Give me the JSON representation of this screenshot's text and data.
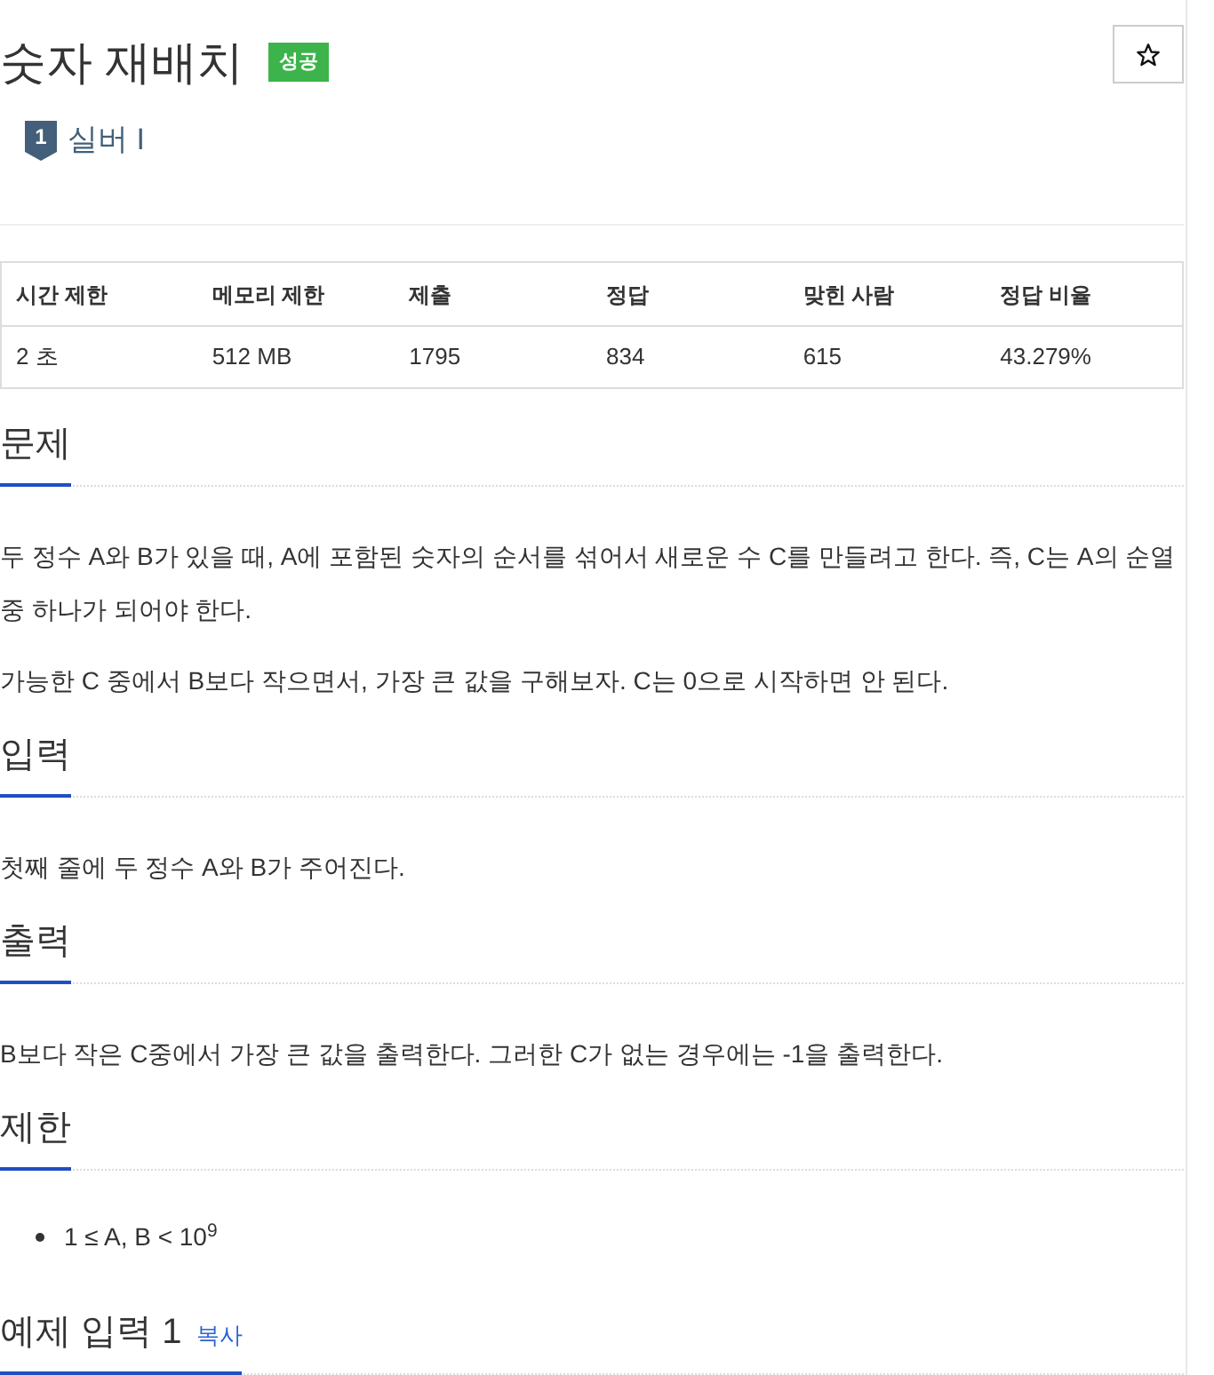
{
  "problem": {
    "title": "숫자 재배치",
    "result_badge": {
      "label": "성공",
      "kind": "success"
    },
    "starred": false
  },
  "tier": {
    "number": "1",
    "label": "실버 I"
  },
  "info_table": {
    "columns": [
      "시간 제한",
      "메모리 제한",
      "제출",
      "정답",
      "맞힌 사람",
      "정답 비율"
    ],
    "rows": [
      [
        "2 초",
        "512 MB",
        "1795",
        "834",
        "615",
        "43.279%"
      ]
    ]
  },
  "sections": [
    {
      "kind": "text",
      "heading": "문제",
      "paragraphs": [
        "두 정수 A와 B가 있을 때, A에 포함된 숫자의 순서를 섞어서 새로운 수 C를 만들려고 한다. 즉, C는 A의 순열 중 하나가 되어야 한다.",
        "가능한 C 중에서 B보다 작으면서, 가장 큰 값을 구해보자. C는 0으로 시작하면 안 된다."
      ]
    },
    {
      "kind": "text",
      "heading": "입력",
      "paragraphs": [
        "첫째 줄에 두 정수 A와 B가 주어진다."
      ]
    },
    {
      "kind": "text",
      "heading": "출력",
      "paragraphs": [
        "B보다 작은 C중에서 가장 큰 값을 출력한다. 그러한 C가 없는 경우에는 -1을 출력한다."
      ]
    },
    {
      "kind": "list",
      "heading": "제한",
      "items": [
        "1 ≤ A, B < 10$^{9}$"
      ]
    },
    {
      "kind": "sample",
      "heading": "예제 입력 1",
      "copy_link": "복사"
    }
  ]
}
